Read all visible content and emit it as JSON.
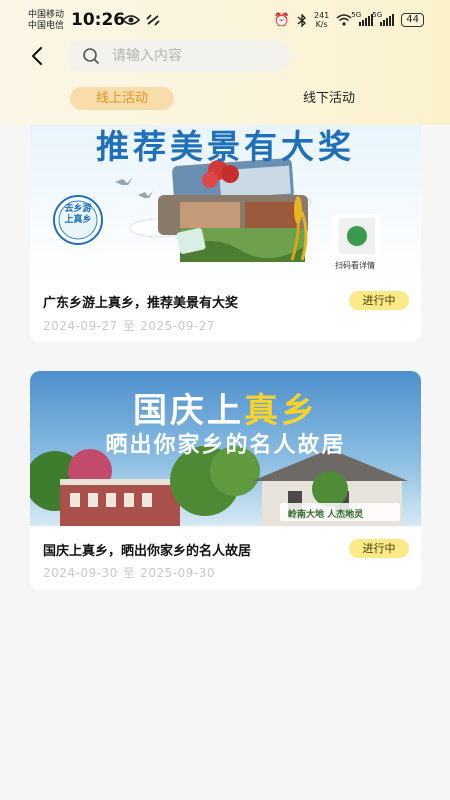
{
  "status_bar": {
    "carrier_1": "中国移动",
    "carrier_2": "中国电信",
    "time": "10:26",
    "net_speed_value": "241",
    "net_speed_unit": "K/s",
    "signal_1_label": "5G",
    "signal_2_label": "5G",
    "battery": "44"
  },
  "header": {
    "search_placeholder": "请输入内容"
  },
  "tabs": [
    {
      "label": "线上活动",
      "active": true
    },
    {
      "label": "线下活动",
      "active": false
    }
  ],
  "activities": [
    {
      "banner_title": "推荐美景有大奖",
      "banner_badge": "去乡游上真乡",
      "qr_label": "扫码看详情",
      "title": "广东乡游上真乡，推荐美景有大奖",
      "status": "进行中",
      "start_date": "2024-09-27",
      "date_separator": "至",
      "end_date": "2025-09-27"
    },
    {
      "banner_title_prefix": "国庆上",
      "banner_title_accent": "真乡",
      "banner_subtitle": "晒出你家乡的名人故居",
      "banner_tag": "岭南大地 人杰地灵",
      "title": "国庆上真乡，晒出你家乡的名人故居",
      "status": "进行中",
      "start_date": "2024-09-30",
      "date_separator": "至",
      "end_date": "2025-09-30"
    }
  ],
  "colors": {
    "accent_orange": "#e79322",
    "tab_active_bg": "#f8dcaa",
    "status_pill_bg": "#fbea87",
    "banner_blue": "#1f70b8"
  }
}
